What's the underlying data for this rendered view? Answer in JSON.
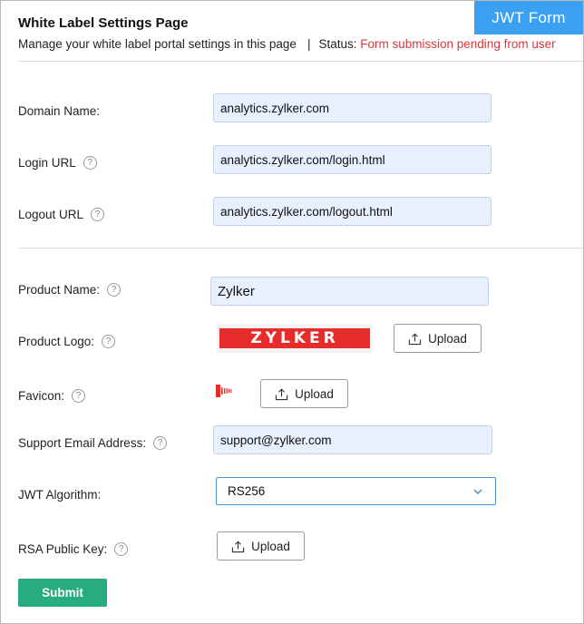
{
  "header": {
    "title": "White Label Settings Page",
    "description": "Manage your white label portal settings in this page",
    "separator": "|",
    "status_label": "Status:",
    "status_value": "Form submission pending from user",
    "tag": "JWT Form"
  },
  "form": {
    "domain": {
      "label": "Domain Name:",
      "value": "analytics.zylker.com"
    },
    "login_url": {
      "label": "Login URL",
      "value": "analytics.zylker.com/login.html"
    },
    "logout_url": {
      "label": "Logout URL",
      "value": "analytics.zylker.com/logout.html"
    },
    "product_name": {
      "label": "Product Name:",
      "value": "Zylker"
    },
    "product_logo": {
      "label": "Product Logo:",
      "logo_text": "ZYLKER",
      "upload_label": "Upload"
    },
    "favicon": {
      "label": "Favicon:",
      "upload_label": "Upload"
    },
    "support_email": {
      "label": "Support Email Address:",
      "value": "support@zylker.com"
    },
    "jwt_algorithm": {
      "label": "JWT Algorithm:",
      "value": "RS256"
    },
    "rsa_public_key": {
      "label": "RSA Public Key:",
      "upload_label": "Upload"
    },
    "help_glyph": "?",
    "submit_label": "Submit"
  },
  "colors": {
    "tag_background": "#3aa0f2",
    "status_red": "#d9373b",
    "submit_green": "#28ab7f",
    "field_background": "#e8f0fe",
    "logo_red": "#e62d2b"
  },
  "icons": {
    "upload": "upload-icon",
    "help": "help-circle-icon",
    "dropdown": "chevron-down-icon",
    "favicon": "zylker-favicon-icon"
  }
}
